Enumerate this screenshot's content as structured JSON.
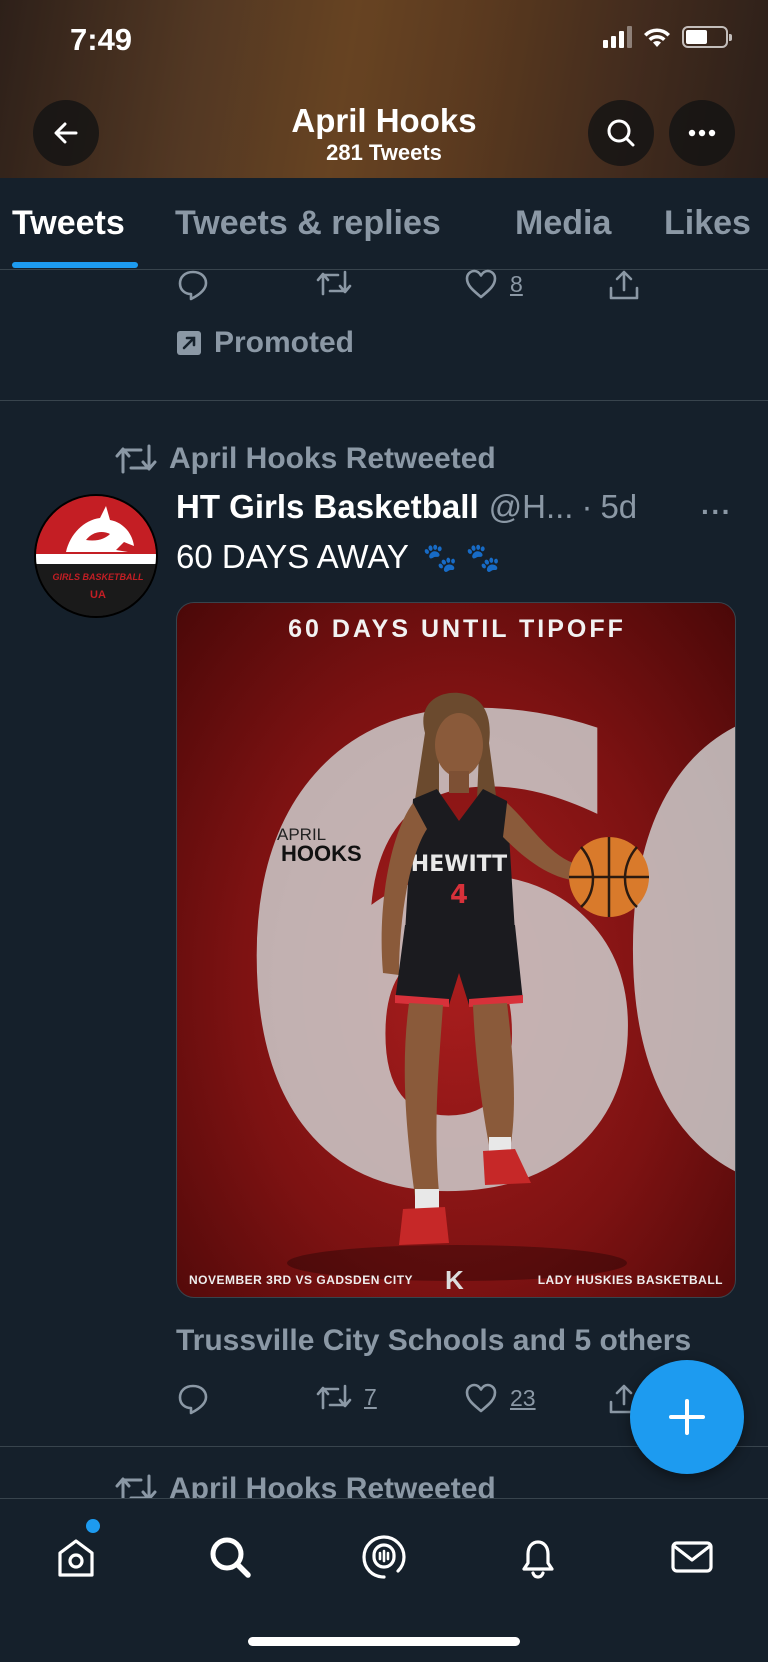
{
  "status_bar": {
    "time": "7:49"
  },
  "header": {
    "name": "April Hooks",
    "tweet_count": "281 Tweets"
  },
  "tabs": [
    {
      "label": "Tweets",
      "active": true
    },
    {
      "label": "Tweets & replies",
      "active": false
    },
    {
      "label": "Media",
      "active": false
    },
    {
      "label": "Likes",
      "active": false
    }
  ],
  "prev_tweet": {
    "like_count": "8",
    "promoted_label": "Promoted"
  },
  "tweet": {
    "retweeted_by": "April Hooks Retweeted",
    "author": "HT Girls Basketball",
    "handle": "@H...",
    "separator": "·",
    "time": "5d",
    "text": "60 DAYS AWAY",
    "emoji": "🐾 🐾",
    "media": {
      "title": "60 DAYS UNTIL TIPOFF",
      "big_number": "60",
      "player_first": "APRIL",
      "player_last": "HOOKS",
      "footer_left": "NOVEMBER 3RD VS GADSDEN CITY",
      "footer_right": "LADY HUSKIES BASKETBALL",
      "footer_logo": "K"
    },
    "social_context": "Trussville City Schools and 5 others",
    "retweet_count": "7",
    "like_count": "23"
  },
  "next_tweet": {
    "retweeted_by": "April Hooks Retweeted"
  },
  "colors": {
    "accent": "#1d9bf0",
    "background": "#15202b",
    "muted": "#8b98a5",
    "divider": "#38444d"
  },
  "icons": [
    "back-arrow-icon",
    "search-icon",
    "more-icon",
    "reply-icon",
    "retweet-icon",
    "like-icon",
    "share-icon",
    "promoted-icon",
    "home-icon",
    "explore-icon",
    "spaces-icon",
    "notifications-icon",
    "messages-icon",
    "compose-icon"
  ]
}
